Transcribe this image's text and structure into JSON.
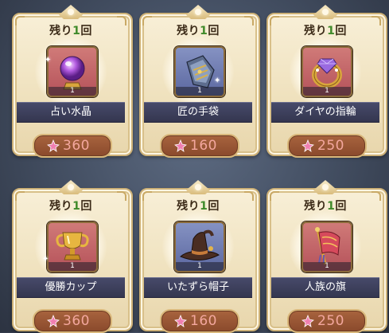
{
  "shop": {
    "items": [
      {
        "remaining_prefix": "残り",
        "remaining_count": "1",
        "remaining_suffix": "回",
        "name": "占い水晶",
        "quantity": "1",
        "price": "360",
        "icon": "crystal-ball-icon",
        "bg": "pink"
      },
      {
        "remaining_prefix": "残り",
        "remaining_count": "1",
        "remaining_suffix": "回",
        "name": "匠の手袋",
        "quantity": "1",
        "price": "160",
        "icon": "gauntlet-icon",
        "bg": "blue"
      },
      {
        "remaining_prefix": "残り",
        "remaining_count": "1",
        "remaining_suffix": "回",
        "name": "ダイヤの指輪",
        "quantity": "1",
        "price": "250",
        "icon": "diamond-ring-icon",
        "bg": "pink"
      },
      {
        "remaining_prefix": "残り",
        "remaining_count": "1",
        "remaining_suffix": "回",
        "name": "優勝カップ",
        "quantity": "1",
        "price": "360",
        "icon": "trophy-cup-icon",
        "bg": "pink"
      },
      {
        "remaining_prefix": "残り",
        "remaining_count": "1",
        "remaining_suffix": "回",
        "name": "いたずら帽子",
        "quantity": "1",
        "price": "160",
        "icon": "witch-hat-icon",
        "bg": "blue"
      },
      {
        "remaining_prefix": "残り",
        "remaining_count": "1",
        "remaining_suffix": "回",
        "name": "人族の旗",
        "quantity": "1",
        "price": "250",
        "icon": "banner-flag-icon",
        "bg": "pink"
      }
    ]
  },
  "colors": {
    "remaining_count": "#3f8a2a",
    "price_text": "#f3a79e",
    "name_plate": "#3b3d58",
    "price_pill": "#9a5634"
  }
}
